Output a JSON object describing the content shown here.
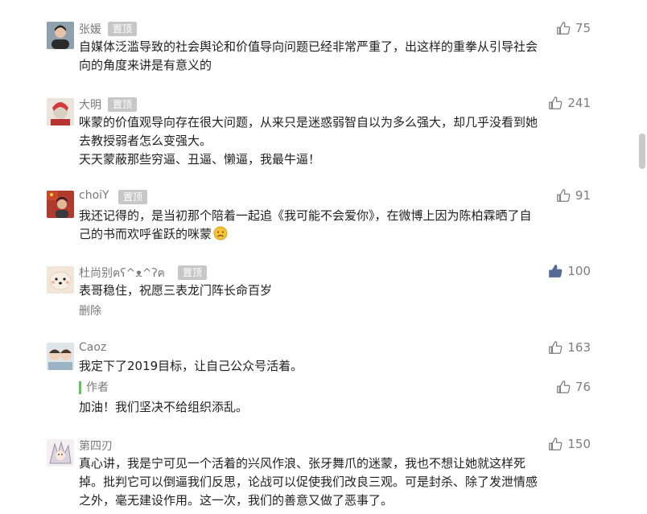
{
  "comments": [
    {
      "nick": "张媛",
      "pin_label": "置顶",
      "likes": "75",
      "lines": [
        "自媒体泛滥导致的社会舆论和价值导向问题已经非常严重了，出这样的重拳从引导社会",
        "向的角度来讲是有意义的"
      ]
    },
    {
      "nick": "大明",
      "pin_label": "置顶",
      "likes": "241",
      "lines": [
        "咪蒙的价值观导向存在很大问题，从来只是迷惑弱智自以为多么强大，却几乎没看到她",
        "去教授弱者怎么变强大。",
        "天天蒙蔽那些穷逼、丑逼、懒逼，我最牛逼！"
      ]
    },
    {
      "nick": "choiY",
      "pin_label": "置顶",
      "likes": "91",
      "lines": [
        "我还记得的，是当初那个陪着一起追《我可能不会爱你》，在微博上因为陈柏霖晒了自",
        "己的书而欢呼雀跃的咪蒙"
      ]
    },
    {
      "nick": "杜尚别ฅʕ^ᴥ^ʔฅ",
      "pin_label": "置顶",
      "likes": "100",
      "lines": [
        "表哥稳住，祝愿三表龙门阵长命百岁"
      ],
      "delete_label": "删除"
    },
    {
      "nick": "Caoz",
      "likes": "163",
      "lines": [
        "我定下了2019目标，让自己公众号活着。"
      ],
      "reply": {
        "author_label": "作者",
        "likes": "76",
        "text": "加油！我们坚决不给组织添乱。"
      }
    },
    {
      "nick": "第四刃",
      "likes": "150",
      "lines": [
        "真心讲，我是宁可见一个活着的兴风作浪、张牙舞爪的迷蒙，我也不想让她就这样死",
        "掉。批判它可以倒逼我们反思，论战可以促使我们改良三观。可是封杀、除了发泄情感",
        "之外，毫无建设作用。这一次，我们的善意又做了恶事了。"
      ]
    }
  ],
  "icons": {
    "like": "thumbs-up-icon",
    "like_color": "#7d7d7d",
    "liked_color": "#576b95",
    "sad_emoji": "sad-face-icon"
  },
  "colors": {
    "author_bar": "#5ec25e",
    "pin_bg": "#c7c7c7"
  }
}
